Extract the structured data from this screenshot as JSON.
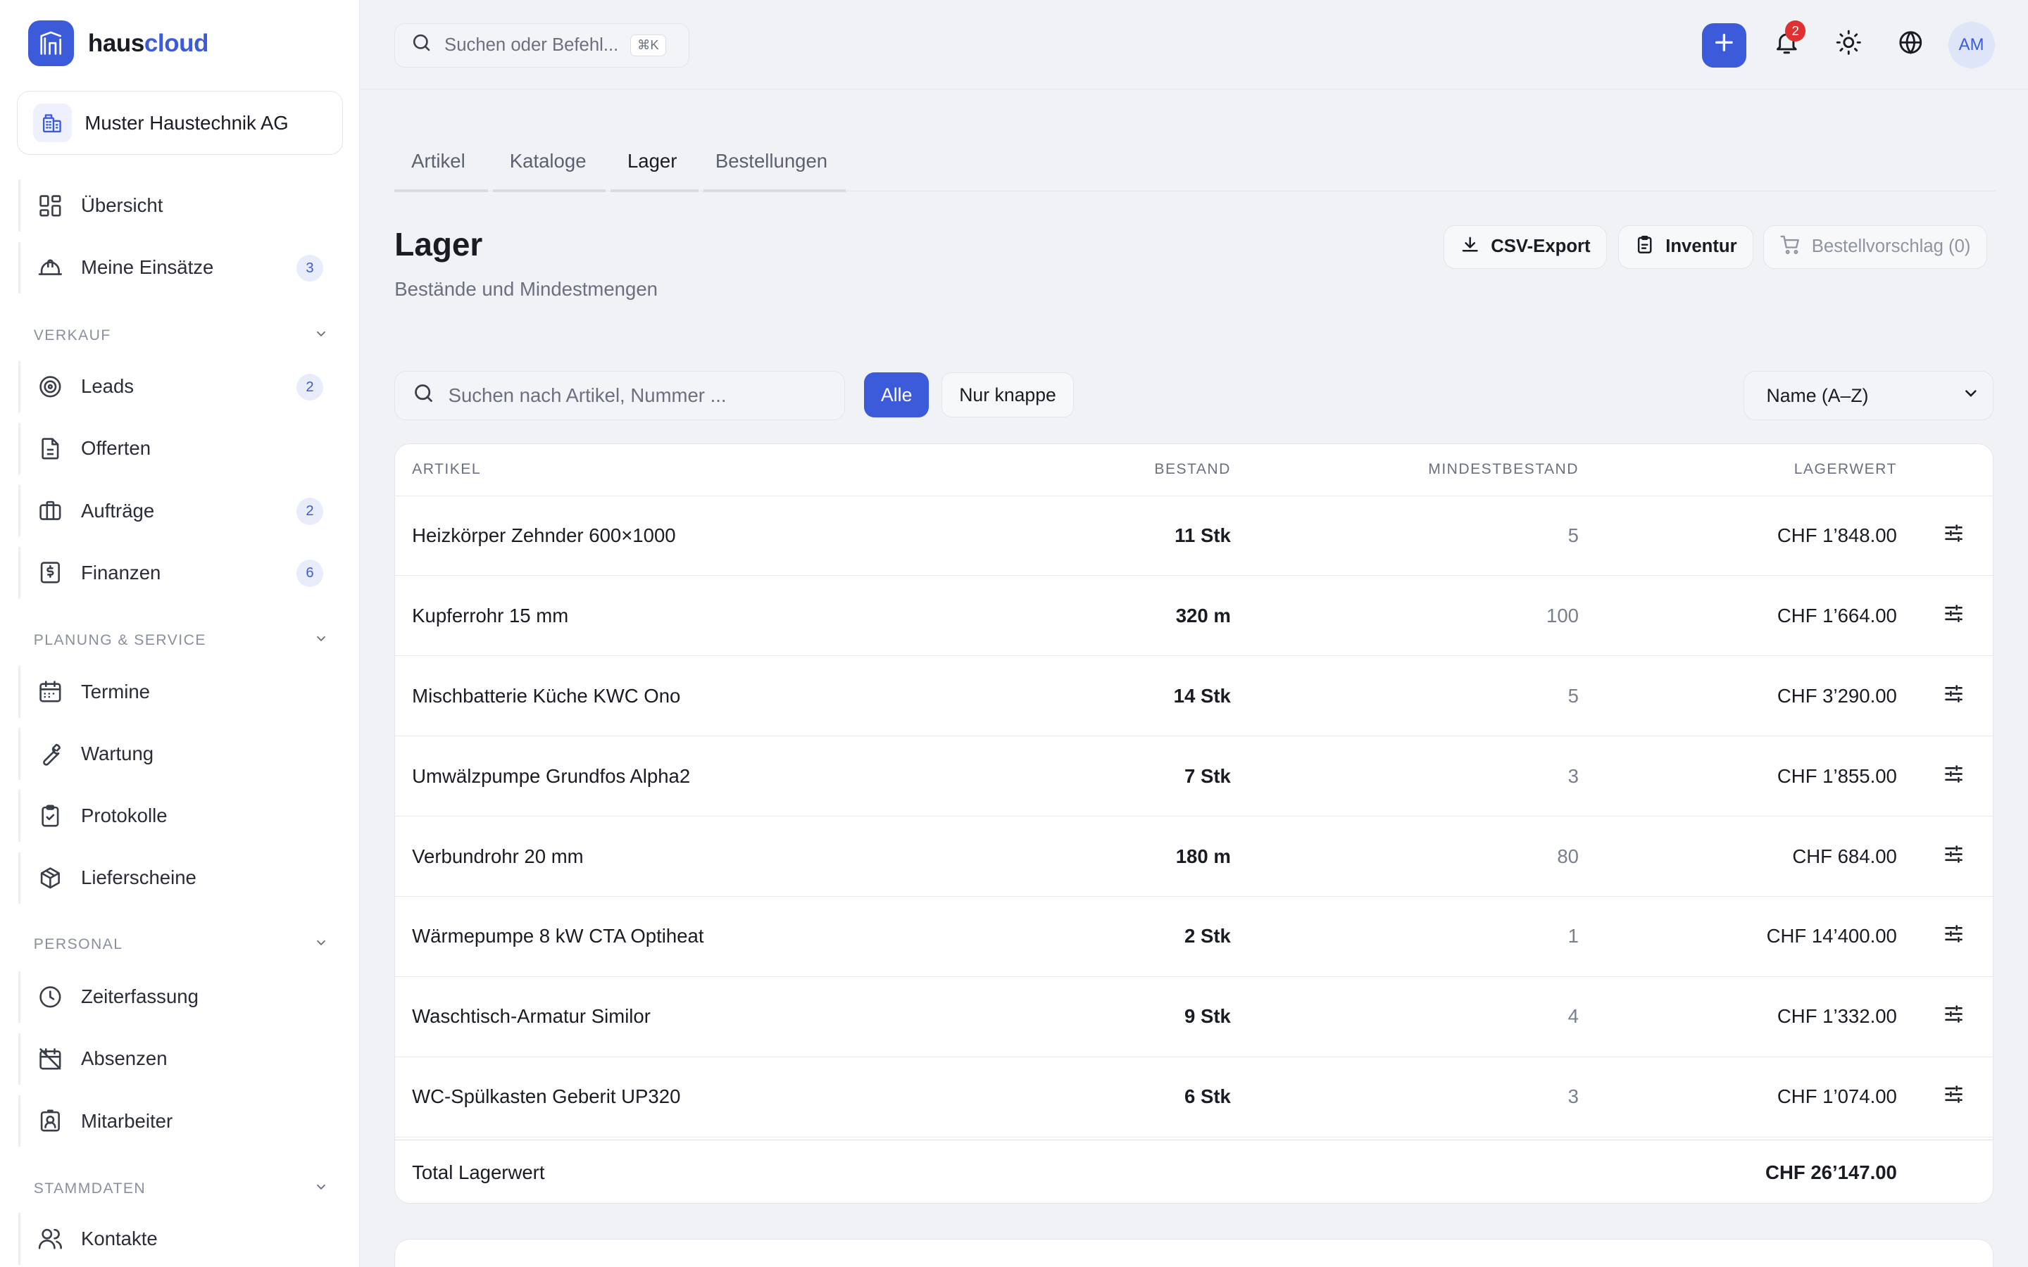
{
  "app": {
    "brand_prefix": "haus",
    "brand_suffix": "cloud",
    "company": "Muster Haustechnik AG"
  },
  "sidebar": {
    "top": [
      {
        "label": "Übersicht",
        "icon": "dashboard-icon"
      },
      {
        "label": "Meine Einsätze",
        "icon": "helmet-icon",
        "badge": "3"
      }
    ],
    "sections": {
      "verkauf": "VERKAUF",
      "planung": "PLANUNG & SERVICE",
      "personal": "PERSONAL",
      "stammdaten": "STAMMDATEN"
    },
    "verkauf": [
      {
        "label": "Leads",
        "icon": "target-icon",
        "badge": "2"
      },
      {
        "label": "Offerten",
        "icon": "document-icon"
      },
      {
        "label": "Aufträge",
        "icon": "briefcase-icon",
        "badge": "2"
      },
      {
        "label": "Finanzen",
        "icon": "invoice-icon",
        "badge": "6"
      }
    ],
    "planung": [
      {
        "label": "Termine",
        "icon": "calendar-icon"
      },
      {
        "label": "Wartung",
        "icon": "wrench-icon"
      },
      {
        "label": "Protokolle",
        "icon": "clipboard-check-icon"
      },
      {
        "label": "Lieferscheine",
        "icon": "package-icon"
      }
    ],
    "personal": [
      {
        "label": "Zeiterfassung",
        "icon": "clock-icon"
      },
      {
        "label": "Absenzen",
        "icon": "calendar-off-icon"
      },
      {
        "label": "Mitarbeiter",
        "icon": "id-badge-icon"
      }
    ],
    "stammdaten": [
      {
        "label": "Kontakte",
        "icon": "users-icon"
      }
    ]
  },
  "header": {
    "search_placeholder": "Suchen oder Befehl...",
    "shortcut": "⌘K",
    "notifications_count": "2",
    "avatar": "AM"
  },
  "tabs": [
    "Artikel",
    "Kataloge",
    "Lager",
    "Bestellungen"
  ],
  "active_tab": "Lager",
  "page": {
    "title": "Lager",
    "subtitle": "Bestände und Mindestmengen",
    "actions": {
      "export": "CSV-Export",
      "inventory": "Inventur",
      "suggestion": "Bestellvorschlag (0)"
    }
  },
  "filters": {
    "search_placeholder": "Suchen nach Artikel, Nummer ...",
    "all": "Alle",
    "low": "Nur knappe",
    "sort": "Name (A–Z)"
  },
  "table": {
    "headers": {
      "article": "ARTIKEL",
      "stock": "BESTAND",
      "min": "MINDESTBESTAND",
      "value": "LAGERWERT"
    },
    "rows": [
      {
        "name": "Heizkörper Zehnder 600×1000",
        "stock": "11 Stk",
        "min": "5",
        "value": "CHF 1’848.00"
      },
      {
        "name": "Kupferrohr 15 mm",
        "stock": "320 m",
        "min": "100",
        "value": "CHF 1’664.00"
      },
      {
        "name": "Mischbatterie Küche KWC Ono",
        "stock": "14 Stk",
        "min": "5",
        "value": "CHF 3’290.00"
      },
      {
        "name": "Umwälzpumpe Grundfos Alpha2",
        "stock": "7 Stk",
        "min": "3",
        "value": "CHF 1’855.00"
      },
      {
        "name": "Verbundrohr 20 mm",
        "stock": "180 m",
        "min": "80",
        "value": "CHF 684.00"
      },
      {
        "name": "Wärmepumpe 8 kW CTA Optiheat",
        "stock": "2 Stk",
        "min": "1",
        "value": "CHF 14’400.00"
      },
      {
        "name": "Waschtisch-Armatur Similor",
        "stock": "9 Stk",
        "min": "4",
        "value": "CHF 1’332.00"
      },
      {
        "name": "WC-Spülkasten Geberit UP320",
        "stock": "6 Stk",
        "min": "3",
        "value": "CHF 1’074.00"
      }
    ],
    "total_label": "Total Lagerwert",
    "total_value": "CHF 26’147.00"
  },
  "colors": {
    "accent": "#3b5bdb",
    "badge_red": "#e03131"
  }
}
